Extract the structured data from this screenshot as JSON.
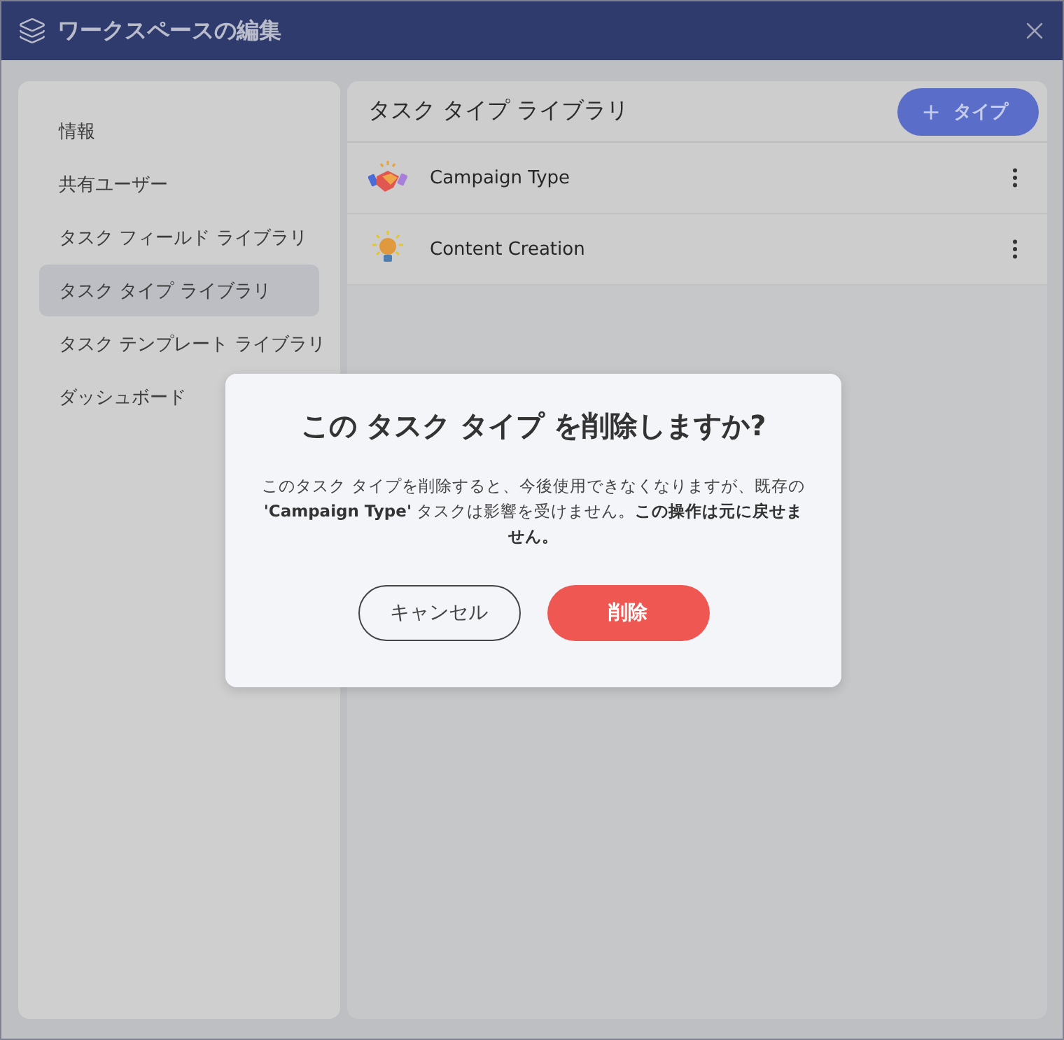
{
  "window": {
    "title": "ワークスペースの編集"
  },
  "sidebar": {
    "items": [
      {
        "label": "情報",
        "selected": false
      },
      {
        "label": "共有ユーザー",
        "selected": false
      },
      {
        "label": "タスク フィールド ライブラリ",
        "selected": false
      },
      {
        "label": "タスク タイプ ライブラリ",
        "selected": true
      },
      {
        "label": "タスク テンプレート ライブラリ",
        "selected": false
      },
      {
        "label": "ダッシュボード",
        "selected": false
      }
    ]
  },
  "panel": {
    "title": "タスク タイプ ライブラリ",
    "add_button": {
      "icon": "＋",
      "label": "タイプ"
    },
    "rows": [
      {
        "kind": "handshake",
        "name": "Campaign Type"
      },
      {
        "kind": "lightbulb",
        "name": "Content Creation"
      }
    ]
  },
  "dialog": {
    "title": "この タスク タイプ を削除しますか?",
    "message": "このタスク タイプを削除すると、今後使用できなくなりますが、既存の **'Campaign Type'** タスクは影響を受けません。**この操作は元に戻せません。**",
    "buttons": [
      {
        "kind": "secondary",
        "label": "キャンセル"
      },
      {
        "kind": "danger",
        "label": "削除"
      }
    ]
  }
}
